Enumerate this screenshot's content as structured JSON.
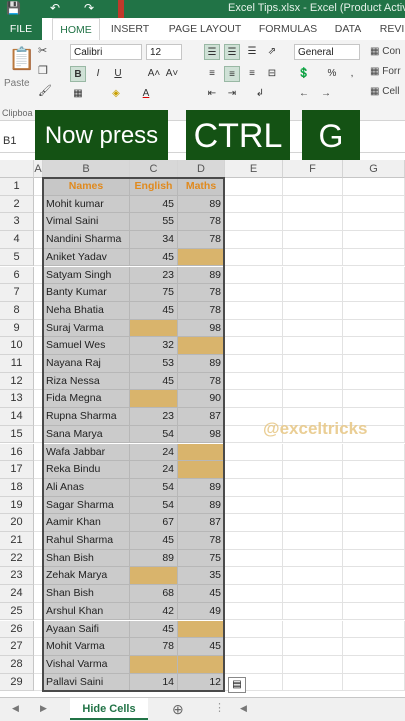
{
  "window": {
    "title": "Excel Tips.xlsx - Excel (Product Activ"
  },
  "tabs": [
    "FILE",
    "HOME",
    "INSERT",
    "PAGE LAYOUT",
    "FORMULAS",
    "DATA",
    "REVI"
  ],
  "ribbon": {
    "paste_label": "Paste",
    "clipboard_label": "Clipboa",
    "font_name": "Calibri",
    "font_size": "12",
    "number_format": "General",
    "con_label": "Con",
    "for_label": "Forr",
    "cell_label": "Cell",
    "bold": "B",
    "italic": "I",
    "underline": "U",
    "font_color_glyph": "A",
    "percent": "%",
    "comma": ","
  },
  "name_box": "B1",
  "overlays": {
    "now_press": "Now press",
    "ctrl": "CTRL",
    "g": "G"
  },
  "grid": {
    "columns": [
      "A",
      "B",
      "C",
      "D",
      "E",
      "F",
      "G"
    ],
    "headers": {
      "name": "Names",
      "english": "English",
      "maths": "Maths"
    },
    "rows": [
      {
        "n": "2",
        "name": "Mohit kumar",
        "english": "45",
        "maths": "89"
      },
      {
        "n": "3",
        "name": "Vimal Saini",
        "english": "55",
        "maths": "78"
      },
      {
        "n": "4",
        "name": "Nandini Sharma",
        "english": "34",
        "maths": "78"
      },
      {
        "n": "5",
        "name": "Aniket Yadav",
        "english": "45",
        "maths": ""
      },
      {
        "n": "6",
        "name": "Satyam Singh",
        "english": "23",
        "maths": "89"
      },
      {
        "n": "7",
        "name": "Banty Kumar",
        "english": "75",
        "maths": "78"
      },
      {
        "n": "8",
        "name": "Neha Bhatia",
        "english": "45",
        "maths": "78"
      },
      {
        "n": "9",
        "name": "Suraj Varma",
        "english": "",
        "maths": "98"
      },
      {
        "n": "10",
        "name": "Samuel Wes",
        "english": "32",
        "maths": ""
      },
      {
        "n": "11",
        "name": "Nayana Raj",
        "english": "53",
        "maths": "89"
      },
      {
        "n": "12",
        "name": "Riza Nessa",
        "english": "45",
        "maths": "78"
      },
      {
        "n": "13",
        "name": "Fida Megna",
        "english": "",
        "maths": "90"
      },
      {
        "n": "14",
        "name": "Rupna Sharma",
        "english": "23",
        "maths": "87"
      },
      {
        "n": "15",
        "name": "Sana Marya",
        "english": "54",
        "maths": "98"
      },
      {
        "n": "16",
        "name": "Wafa Jabbar",
        "english": "24",
        "maths": ""
      },
      {
        "n": "17",
        "name": "Reka Bindu",
        "english": "24",
        "maths": ""
      },
      {
        "n": "18",
        "name": "Ali Anas",
        "english": "54",
        "maths": "89"
      },
      {
        "n": "19",
        "name": "Sagar Sharma",
        "english": "54",
        "maths": "89"
      },
      {
        "n": "20",
        "name": "Aamir Khan",
        "english": "67",
        "maths": "87"
      },
      {
        "n": "21",
        "name": "Rahul Sharma",
        "english": "45",
        "maths": "78"
      },
      {
        "n": "22",
        "name": "Shan Bish",
        "english": "89",
        "maths": "75"
      },
      {
        "n": "23",
        "name": "Zehak Marya",
        "english": "",
        "maths": "35"
      },
      {
        "n": "24",
        "name": "Shan Bish",
        "english": "68",
        "maths": "45"
      },
      {
        "n": "25",
        "name": "Arshul Khan",
        "english": "42",
        "maths": "49"
      },
      {
        "n": "26",
        "name": "Ayaan Saifi",
        "english": "45",
        "maths": ""
      },
      {
        "n": "27",
        "name": "Mohit Varma",
        "english": "78",
        "maths": "45"
      },
      {
        "n": "28",
        "name": "Vishal Varma",
        "english": "",
        "maths": ""
      },
      {
        "n": "29",
        "name": "Pallavi Saini",
        "english": "14",
        "maths": "12"
      }
    ]
  },
  "watermark": "@exceltricks",
  "sheet_tab": "Hide Cells",
  "colors": {
    "excel_green": "#217346",
    "overlay_green": "#145214",
    "blank_cell": "#d9b46c",
    "header_text": "#e08a1e"
  }
}
